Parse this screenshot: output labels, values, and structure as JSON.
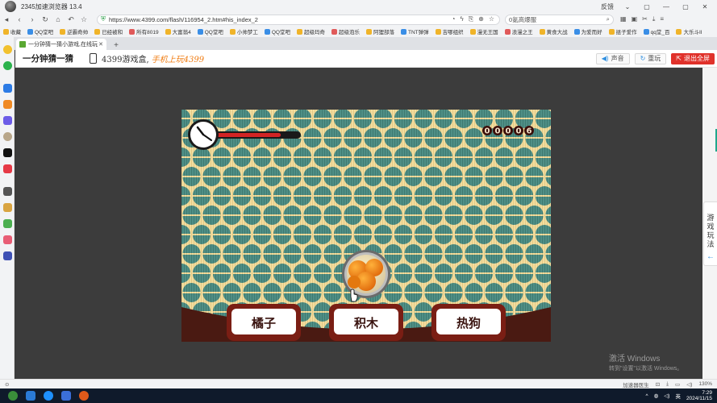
{
  "window": {
    "title": "2345加速浏览器 13.4",
    "right_controls": [
      "反馈",
      "⌄",
      "▢",
      "—",
      "▢",
      "✕"
    ]
  },
  "address_bar": {
    "url": "https://www.4399.com/flash/116954_2.htm#his_index_2",
    "search_placeholder": "0氪高爆服",
    "nav_icons": [
      "back-icon",
      "forward-icon",
      "reload-icon",
      "home-icon",
      "undo-icon",
      "star-icon"
    ]
  },
  "bookmarks": [
    "收藏",
    "QQ堂吧",
    "逆霸奇帅",
    "已经被和",
    "所有8019",
    "大富翁4",
    "QQ堂吧",
    "小帅梦工",
    "QQ堂吧",
    "超级玛奇",
    "超级泡乐",
    "阿狸部落",
    "TNT弹弹",
    "吉哪组织",
    "漫无王国",
    "浪漫之王",
    "黄食大战",
    "为爱而好",
    "拯子爱作",
    "qq堂_百",
    "大乐斗II"
  ],
  "tab": {
    "title": "一分钟猜一猜小游戏,在线玩",
    "new_tab": "+"
  },
  "site_header": {
    "game_title": "一分钟猜一猜",
    "promo_text": "4399游戏盒,",
    "promo_highlight": "手机上玩4399",
    "sound_label": "声音",
    "refresh_label": "重玩",
    "fullscreen_label": "退出全屏"
  },
  "game": {
    "score_digits": "00006",
    "timer_fill": 0.78,
    "revealed_item": "orange",
    "choices": [
      "橘子",
      "积木",
      "热狗"
    ],
    "colors": {
      "background_cream": "#f2dd9f",
      "pattern_teal": "#4f8f86",
      "floor_brown": "#4a1a12",
      "button_frame": "#7a1e14",
      "timer_red": "#d22424"
    }
  },
  "rule_tab": {
    "chars": [
      "游",
      "戏",
      "玩",
      "法"
    ],
    "arrow": "←"
  },
  "status_bar": {
    "left": "⊙",
    "accelerator": "加速器医生",
    "zoom": "130%"
  },
  "taskbar": {
    "time": "7:29",
    "date": "2024/11/15",
    "tray_lang": "英"
  },
  "watermark": {
    "line1": "激活 Windows",
    "line2": "转到\"设置\"以激活 Windows。"
  }
}
